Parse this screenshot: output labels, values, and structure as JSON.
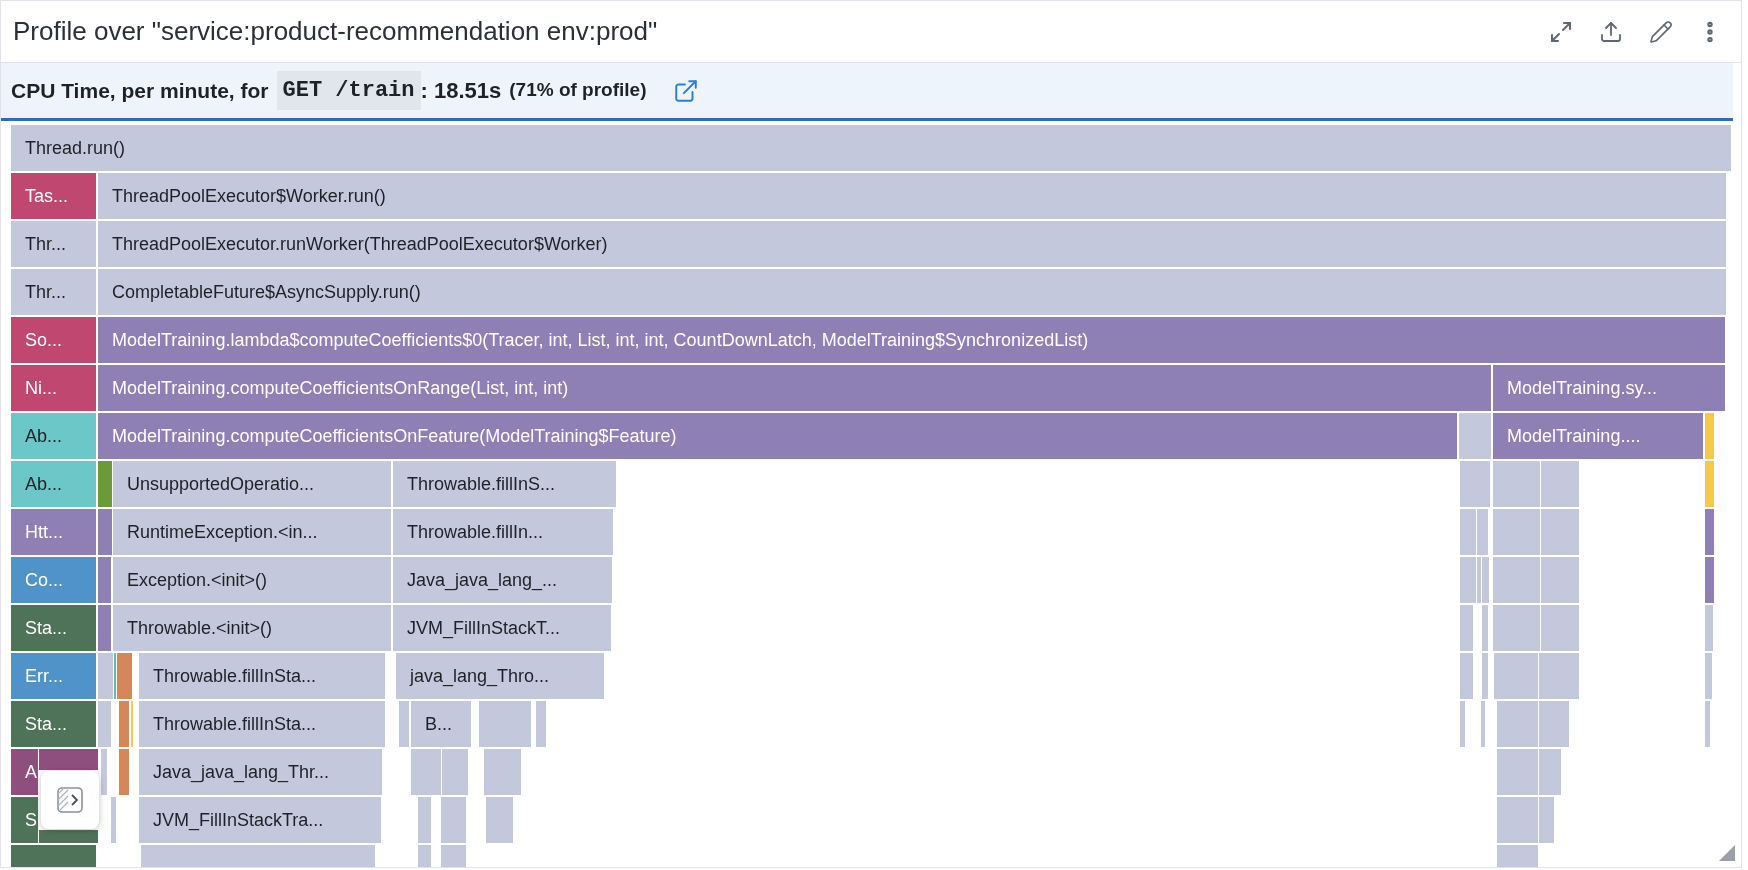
{
  "header": {
    "title": "Profile over \"service:product-recommendation env:prod\""
  },
  "summary": {
    "prefix": "CPU Time, per minute, for",
    "endpoint": "GET /train",
    "value": ": 18.51s",
    "share": "(71% of profile)"
  },
  "flame_graph": {
    "rows": [
      {
        "frames": [
          {
            "label": "Thread.run()",
            "color": "#c3c8dc"
          }
        ]
      },
      {
        "frames": [
          {
            "label": "Tas...",
            "color": "#c0476f"
          },
          {
            "label": "ThreadPoolExecutor$Worker.run()",
            "color": "#c3c8dc"
          }
        ]
      },
      {
        "frames": [
          {
            "label": "Thr...",
            "color": "#c3c8dc"
          },
          {
            "label": "ThreadPoolExecutor.runWorker(ThreadPoolExecutor$Worker)",
            "color": "#c3c8dc"
          }
        ]
      },
      {
        "frames": [
          {
            "label": "Thr...",
            "color": "#c3c8dc"
          },
          {
            "label": "CompletableFuture$AsyncSupply.run()",
            "color": "#c3c8dc"
          }
        ]
      },
      {
        "frames": [
          {
            "label": "So...",
            "color": "#c0476f"
          },
          {
            "label": "ModelTraining.lambda$computeCoefficients$0(Tracer, int, List, int, int, CountDownLatch, ModelTraining$SynchronizedList)",
            "color": "#8e7fb5"
          }
        ]
      },
      {
        "frames": [
          {
            "label": "Ni...",
            "color": "#c0476f"
          },
          {
            "label": "ModelTraining.computeCoefficientsOnRange(List, int, int)",
            "color": "#8e7fb5"
          },
          {
            "label": "ModelTraining.sy...",
            "color": "#8e7fb5"
          }
        ]
      },
      {
        "frames": [
          {
            "label": "Ab...",
            "color": "#6cc8c8"
          },
          {
            "label": "ModelTraining.computeCoefficientsOnFeature(ModelTraining$Feature)",
            "color": "#8e7fb5"
          },
          {
            "label": "ModelTraining....",
            "color": "#8e7fb5"
          }
        ]
      },
      {
        "frames": [
          {
            "label": "Ab...",
            "color": "#6cc8c8"
          },
          {
            "label": "UnsupportedOperatio...",
            "color": "#c3c8dc"
          },
          {
            "label": "Throwable.fillInS...",
            "color": "#c3c8dc"
          }
        ]
      },
      {
        "frames": [
          {
            "label": "Htt...",
            "color": "#8e7fb5"
          },
          {
            "label": "RuntimeException.<in...",
            "color": "#c3c8dc"
          },
          {
            "label": "Throwable.fillIn...",
            "color": "#c3c8dc"
          }
        ]
      },
      {
        "frames": [
          {
            "label": "Co...",
            "color": "#4f93c8"
          },
          {
            "label": "Exception.<init>()",
            "color": "#c3c8dc"
          },
          {
            "label": "Java_java_lang_...",
            "color": "#c3c8dc"
          }
        ]
      },
      {
        "frames": [
          {
            "label": "Sta...",
            "color": "#4f7358"
          },
          {
            "label": "Throwable.<init>()",
            "color": "#c3c8dc"
          },
          {
            "label": "JVM_FillInStackT...",
            "color": "#c3c8dc"
          }
        ]
      },
      {
        "frames": [
          {
            "label": "Err...",
            "color": "#4f93c8"
          },
          {
            "label": "Throwable.fillInSta...",
            "color": "#c3c8dc"
          },
          {
            "label": "java_lang_Thro...",
            "color": "#c3c8dc"
          }
        ]
      },
      {
        "frames": [
          {
            "label": "Sta...",
            "color": "#4f7358"
          },
          {
            "label": "Throwable.fillInSta...",
            "color": "#c3c8dc"
          },
          {
            "label": "B...",
            "color": "#c3c8dc"
          }
        ]
      },
      {
        "frames": [
          {
            "label": "A",
            "color": "#8e4f7f"
          },
          {
            "label": "Java_java_lang_Thr...",
            "color": "#c3c8dc"
          }
        ]
      },
      {
        "frames": [
          {
            "label": "S",
            "color": "#4f7358"
          },
          {
            "label": "JVM_FillInStackTra...",
            "color": "#c3c8dc"
          }
        ]
      },
      {
        "frames": [
          {
            "color": "#4f7358"
          },
          {
            "color": "#c3c8dc"
          }
        ]
      }
    ]
  }
}
